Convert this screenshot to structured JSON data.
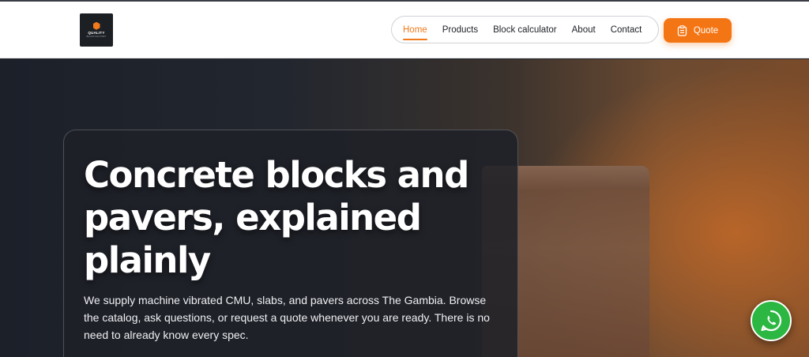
{
  "header": {
    "logo": {
      "text": "QUALITY",
      "subtext": "BLOCK FACTORY"
    },
    "nav": [
      {
        "label": "Home",
        "active": true
      },
      {
        "label": "Products",
        "active": false
      },
      {
        "label": "Block calculator",
        "active": false
      },
      {
        "label": "About",
        "active": false
      },
      {
        "label": "Contact",
        "active": false
      }
    ],
    "quote_button": {
      "label": "Quote",
      "icon": "clipboard-icon"
    }
  },
  "hero": {
    "title": "Concrete blocks and pavers, explained plainly",
    "body": "We supply machine vibrated CMU, slabs, and pavers across The Gambia. Browse the catalog, ask questions, or request a quote whenever you are ready. There is no need to already know every spec."
  },
  "floating": {
    "icon": "whatsapp-icon"
  },
  "colors": {
    "accent": "#f47514",
    "whatsapp": "#2bb741",
    "hero_dark": "#1f232b"
  }
}
